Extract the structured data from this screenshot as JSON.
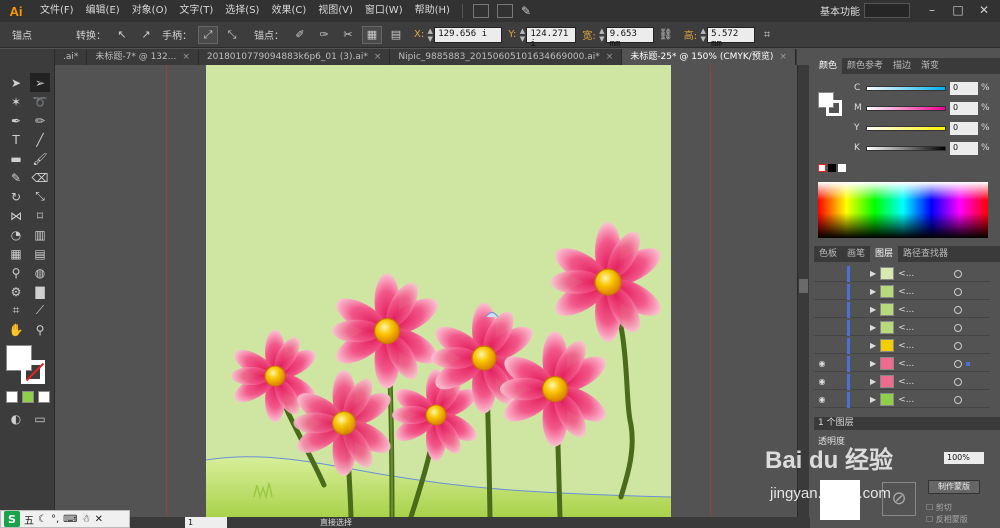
{
  "app": {
    "logo": "Ai",
    "workspace": "基本功能"
  },
  "menu": [
    "文件(F)",
    "编辑(E)",
    "对象(O)",
    "文字(T)",
    "选择(S)",
    "效果(C)",
    "视图(V)",
    "窗口(W)",
    "帮助(H)"
  ],
  "control": {
    "anchor_label": "锚点",
    "convert_label": "转换：",
    "handle_label": "手柄：",
    "anchor2_label": "锚点：",
    "x_label": "X:",
    "x_value": "129.656 i",
    "y_label": "Y:",
    "y_value": "124.271 i",
    "w_label": "宽:",
    "w_value": "9.653 mm",
    "h_label": "高:",
    "h_value": "5.572 mm"
  },
  "tabs": [
    {
      "label": ".ai*"
    },
    {
      "label": "未标题-7* @ 132..."
    },
    {
      "label": "2018010779094883k6p6_01 (3).ai*"
    },
    {
      "label": "Nipic_9885883_20150605101634669000.ai*"
    },
    {
      "label": "未标题-25* @ 150% (CMYK/预览)",
      "active": true
    }
  ],
  "color_panel": {
    "tabs": [
      "颜色",
      "颜色参考",
      "描边",
      "渐变"
    ],
    "channels": [
      {
        "label": "C",
        "value": "0",
        "unit": "%",
        "color": "linear-gradient(to right,#fff,#00aeef)"
      },
      {
        "label": "M",
        "value": "0",
        "unit": "%",
        "color": "linear-gradient(to right,#fff,#ec008c)"
      },
      {
        "label": "Y",
        "value": "0",
        "unit": "%",
        "color": "linear-gradient(to right,#fff,#fff200)"
      },
      {
        "label": "K",
        "value": "0",
        "unit": "%",
        "color": "linear-gradient(to right,#fff,#000)"
      }
    ]
  },
  "layers_panel": {
    "tabs": [
      "色板",
      "画笔",
      "图层",
      "路径查找器"
    ],
    "rows": [
      {
        "name": "<...",
        "visible": false,
        "thumb": "#d7e9b0"
      },
      {
        "name": "<...",
        "visible": false,
        "thumb": "#b7da7a"
      },
      {
        "name": "<...",
        "visible": false,
        "thumb": "#b7da7a"
      },
      {
        "name": "<...",
        "visible": false,
        "thumb": "#b7da7a"
      },
      {
        "name": "<...",
        "visible": false,
        "thumb": "#f2d000"
      },
      {
        "name": "<...",
        "visible": true,
        "thumb": "#f06a8e",
        "selected": true
      },
      {
        "name": "<...",
        "visible": true,
        "thumb": "#f06a8e"
      },
      {
        "name": "<...",
        "visible": true,
        "thumb": "#8fcf4a"
      },
      {
        "name": "<...",
        "visible": true,
        "thumb": "#cfe6a3"
      }
    ],
    "footer": "1 个图层"
  },
  "transparency": {
    "title": "透明度",
    "opacity": "100%",
    "make_mask": "制作蒙版",
    "clip": "剪切",
    "invert": "反相蒙版"
  },
  "status": {
    "zoom": "150%",
    "page": "1",
    "tool": "直接选择"
  },
  "ime": {
    "label": "五"
  },
  "watermark": {
    "brand": "Bai du 经验",
    "url": "jingyan.baidu.com"
  },
  "colors": {
    "artboard": "#cfe6a3",
    "petal": "#f0437a",
    "center": "#f9c400",
    "stem": "#4a6a1c",
    "grass": "#b9dc5a"
  }
}
